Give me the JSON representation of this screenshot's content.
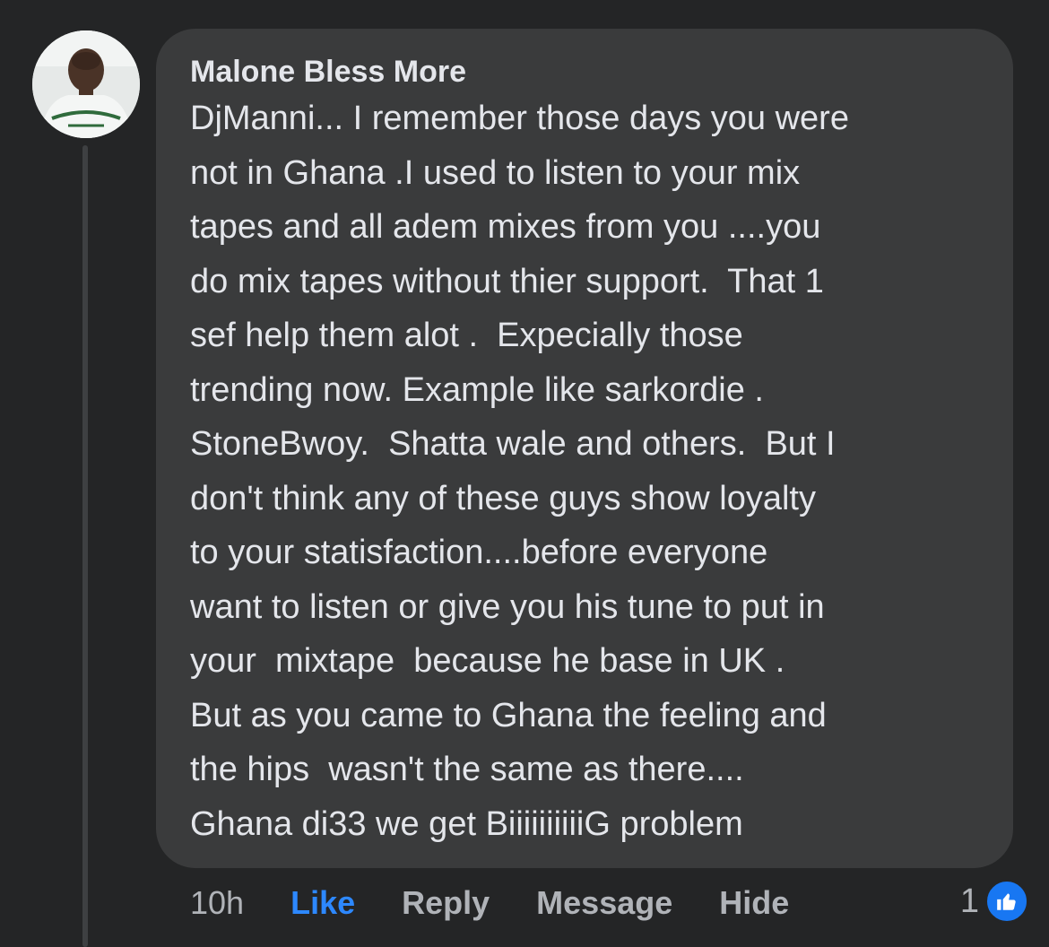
{
  "comment": {
    "author": "Malone Bless More",
    "lines": [
      "DjManni... I remember those days you were",
      "not in Ghana .I used to listen to your mix",
      "tapes and all adem mixes from you ....you",
      "do mix tapes without thier support.  That 1",
      "sef help them alot .  Expecially those",
      "trending now. Example like sarkordie .",
      "StoneBwoy.  Shatta wale and others.  But I",
      "don't think any of these guys show loyalty",
      "to your statisfaction....before everyone",
      "want to listen or give you his tune to put in",
      "your  mixtape  because he base in UK .",
      "But as you came to Ghana the feeling and",
      "the hips  wasn't the same as there....",
      "Ghana di33 we get BiiiiiiiiiiG problem"
    ],
    "time": "10h",
    "actions": {
      "like": "Like",
      "reply": "Reply",
      "message": "Message",
      "hide": "Hide"
    },
    "reaction_count": "1",
    "reaction_icon": "thumbs-up-icon"
  },
  "colors": {
    "background": "#242526",
    "bubble": "#3a3b3c",
    "like_active": "#2d88ff",
    "muted_text": "#b0b3b8",
    "reaction_badge": "#1877f2"
  }
}
